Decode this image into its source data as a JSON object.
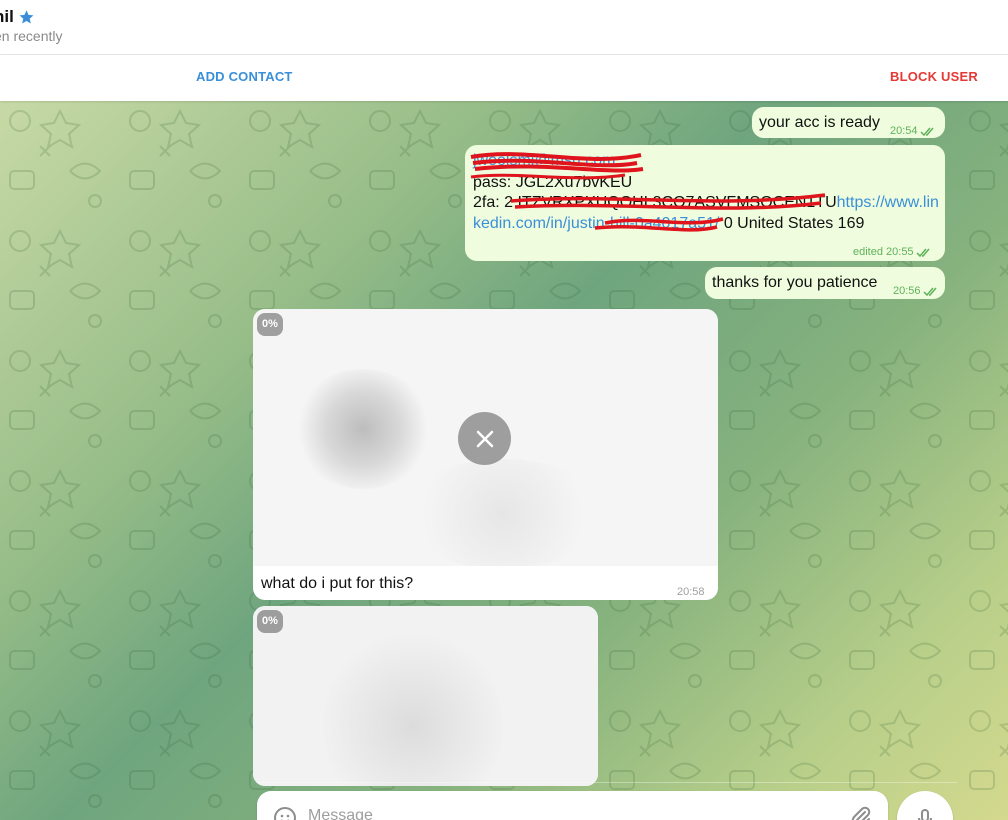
{
  "header": {
    "title": "hil",
    "status": "en recently"
  },
  "actions": {
    "add_contact": "ADD CONTACT",
    "block_user": "BLOCK USER"
  },
  "messages": [
    {
      "text": "your acc is ready",
      "time": "20:54"
    },
    {
      "line1": "jwoolsmi@msn.com",
      "line2": "pass: JGL2Xu7bvKEU",
      "line3_prefix": "2fa: ",
      "line3_code": "2 ITZVRXPXUQOHL3CO7ASVFMSOCEN1TU",
      "line3_link": "https://www.lin",
      "line4_link": "kedin.com/in/justin-hill-0a4017a51/",
      "line4_rest": " 0 United States 169",
      "time": "edited 20:55"
    },
    {
      "text": "thanks for you patience",
      "time": "20:56"
    },
    {
      "progress": "0%",
      "caption": "what do i put for this?",
      "time": "20:58"
    },
    {
      "progress": "0%"
    }
  ],
  "composer": {
    "placeholder": "Message"
  },
  "colors": {
    "accent": "#3a8fd8",
    "danger": "#e53935",
    "outgoing_bubble": "#effdde",
    "read_check": "#5fb25a"
  }
}
